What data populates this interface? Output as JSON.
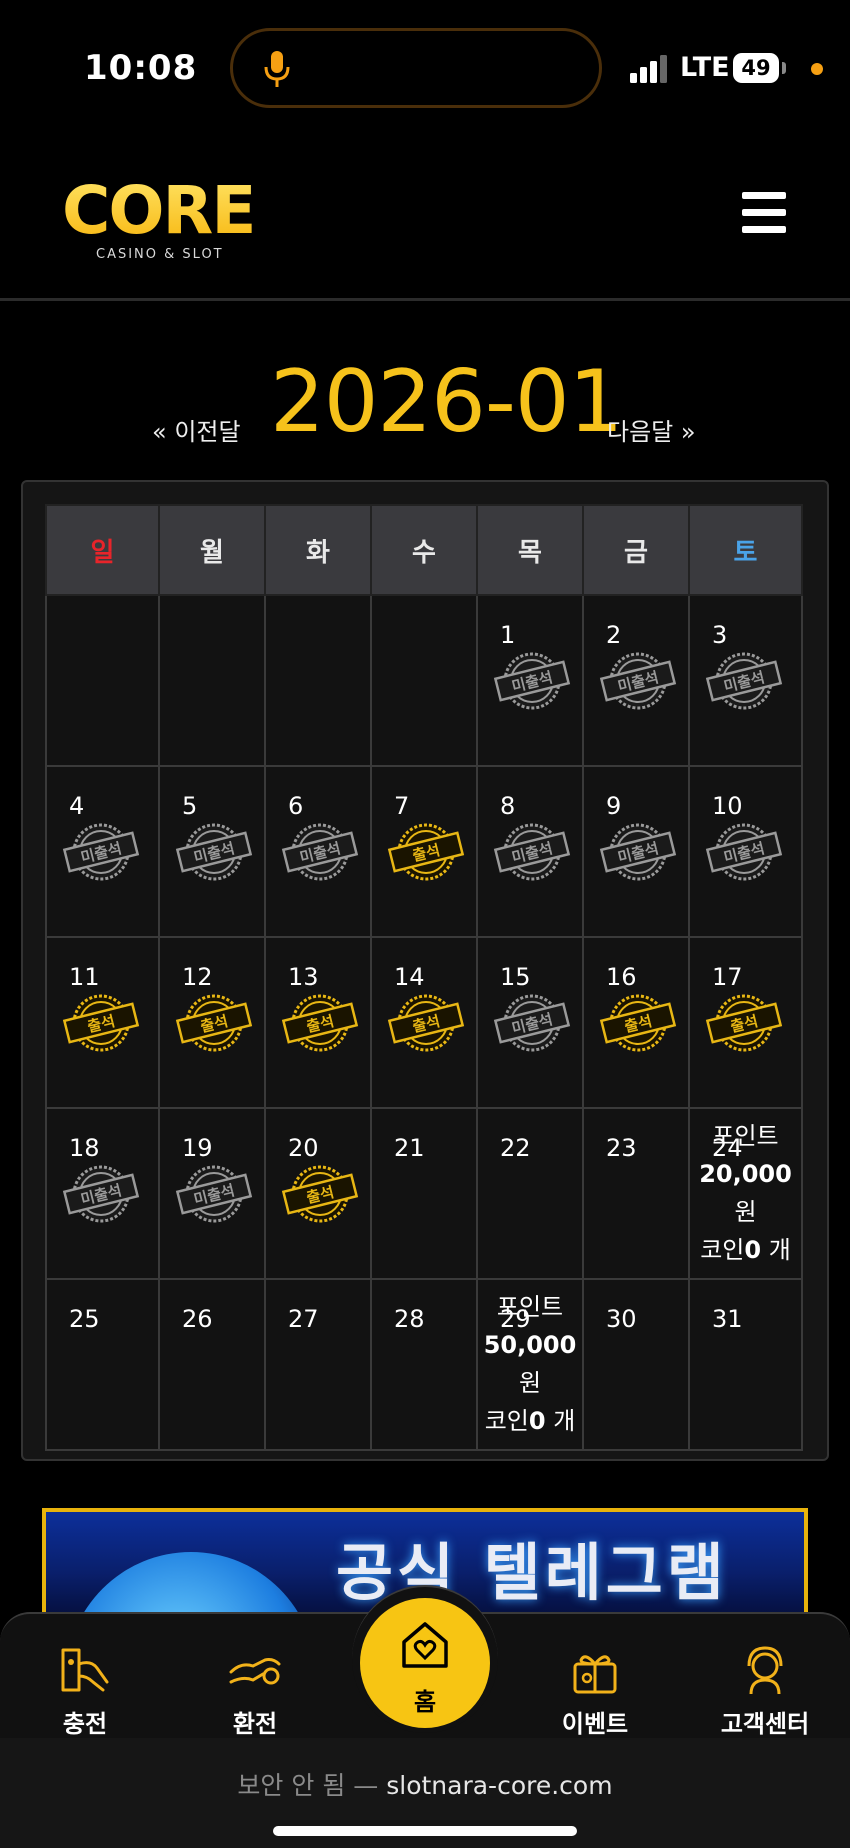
{
  "status_bar": {
    "time": "10:08",
    "network": "LTE",
    "battery": "49",
    "accent_color": "#f6a013"
  },
  "header": {
    "logo_word": "CORE",
    "logo_sub": "CASINO & SLOT",
    "menu_icon": "hamburger-icon"
  },
  "month_nav": {
    "prev": "« 이전달",
    "title": "2026-01",
    "next": "다음달 »"
  },
  "calendar": {
    "weekdays": [
      {
        "label": "일",
        "color": "#e8242a"
      },
      {
        "label": "월",
        "color": "#e9e9e9"
      },
      {
        "label": "화",
        "color": "#e9e9e9"
      },
      {
        "label": "수",
        "color": "#e9e9e9"
      },
      {
        "label": "목",
        "color": "#e9e9e9"
      },
      {
        "label": "금",
        "color": "#e9e9e9"
      },
      {
        "label": "토",
        "color": "#4aa3e8"
      }
    ],
    "stamp_labels": {
      "attended": "출석",
      "absent": "미출석"
    },
    "weeks": [
      [
        {
          "day": "",
          "status": ""
        },
        {
          "day": "",
          "status": ""
        },
        {
          "day": "",
          "status": ""
        },
        {
          "day": "",
          "status": ""
        },
        {
          "day": "1",
          "status": "absent"
        },
        {
          "day": "2",
          "status": "absent"
        },
        {
          "day": "3",
          "status": "absent"
        }
      ],
      [
        {
          "day": "4",
          "status": "absent"
        },
        {
          "day": "5",
          "status": "absent"
        },
        {
          "day": "6",
          "status": "absent"
        },
        {
          "day": "7",
          "status": "attended"
        },
        {
          "day": "8",
          "status": "absent"
        },
        {
          "day": "9",
          "status": "absent"
        },
        {
          "day": "10",
          "status": "absent"
        }
      ],
      [
        {
          "day": "11",
          "status": "attended"
        },
        {
          "day": "12",
          "status": "attended"
        },
        {
          "day": "13",
          "status": "attended"
        },
        {
          "day": "14",
          "status": "attended"
        },
        {
          "day": "15",
          "status": "absent"
        },
        {
          "day": "16",
          "status": "attended"
        },
        {
          "day": "17",
          "status": "attended"
        }
      ],
      [
        {
          "day": "18",
          "status": "absent"
        },
        {
          "day": "19",
          "status": "absent"
        },
        {
          "day": "20",
          "status": "attended"
        },
        {
          "day": "21",
          "status": ""
        },
        {
          "day": "22",
          "status": ""
        },
        {
          "day": "23",
          "status": ""
        },
        {
          "day": "24",
          "status": "",
          "reward": {
            "line1": "포인트",
            "amount": "20,000",
            "unit": "원",
            "coin_pre": "코인",
            "coin_amt": "0",
            "coin_post": " 개"
          }
        }
      ],
      [
        {
          "day": "25",
          "status": ""
        },
        {
          "day": "26",
          "status": ""
        },
        {
          "day": "27",
          "status": ""
        },
        {
          "day": "28",
          "status": ""
        },
        {
          "day": "29",
          "status": "",
          "reward": {
            "line1": "포인트",
            "amount": "50,000",
            "unit": "원",
            "coin_pre": "코인",
            "coin_amt": "0",
            "coin_post": " 개"
          }
        },
        {
          "day": "30",
          "status": ""
        },
        {
          "day": "31",
          "status": ""
        }
      ]
    ]
  },
  "banner": {
    "text": "공식 텔레그램"
  },
  "bottom_nav": {
    "items": [
      {
        "label": "충전",
        "icon": "charge-icon"
      },
      {
        "label": "환전",
        "icon": "exchange-icon"
      },
      {
        "label": "홈",
        "icon": "home-heart-icon"
      },
      {
        "label": "이벤트",
        "icon": "gift-icon"
      },
      {
        "label": "고객센터",
        "icon": "support-icon"
      }
    ],
    "home_color": "#f7c513",
    "icon_color": "#f2b21a"
  },
  "url_bar": {
    "insecure": "보안 안 됨 —",
    "domain": "slotnara-core.com"
  }
}
